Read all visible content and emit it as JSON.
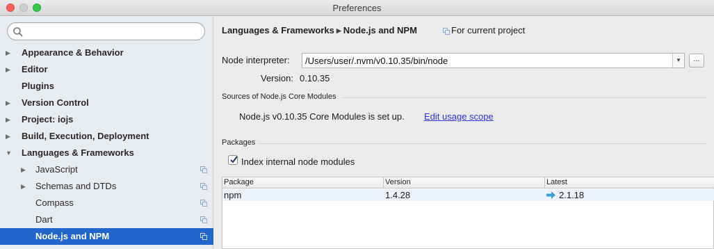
{
  "window": {
    "title": "Preferences"
  },
  "sidebar": {
    "search_placeholder": "",
    "items": [
      {
        "label": "Appearance & Behavior"
      },
      {
        "label": "Editor"
      },
      {
        "label": "Plugins"
      },
      {
        "label": "Version Control"
      },
      {
        "label": "Project: iojs"
      },
      {
        "label": "Build, Execution, Deployment"
      },
      {
        "label": "Languages & Frameworks"
      },
      {
        "label": "JavaScript"
      },
      {
        "label": "Schemas and DTDs"
      },
      {
        "label": "Compass"
      },
      {
        "label": "Dart"
      },
      {
        "label": "Node.js and NPM"
      }
    ]
  },
  "main": {
    "breadcrumb": {
      "parent": "Languages & Frameworks",
      "current": "Node.js and NPM"
    },
    "scope_label": "For current project",
    "interpreter": {
      "label": "Node interpreter:",
      "value": "/Users/user/.nvm/v0.10.35/bin/node",
      "browse_label": "..."
    },
    "version": {
      "label": "Version:",
      "value": "0.10.35"
    },
    "core_modules": {
      "section_title": "Sources of Node.js Core Modules",
      "status_text": "Node.js v0.10.35 Core Modules is set up.",
      "link_text": "Edit usage scope"
    },
    "packages": {
      "section_title": "Packages",
      "checkbox_label": "Index internal node modules",
      "checkbox_checked": true,
      "columns": [
        "Package",
        "Version",
        "Latest"
      ],
      "rows": [
        {
          "package": "npm",
          "version": "1.4.28",
          "latest": "2.1.18"
        }
      ]
    }
  },
  "colors": {
    "selection": "#2266cc",
    "link": "#2a33d9",
    "upgrade_arrow": "#3aa0d8"
  }
}
